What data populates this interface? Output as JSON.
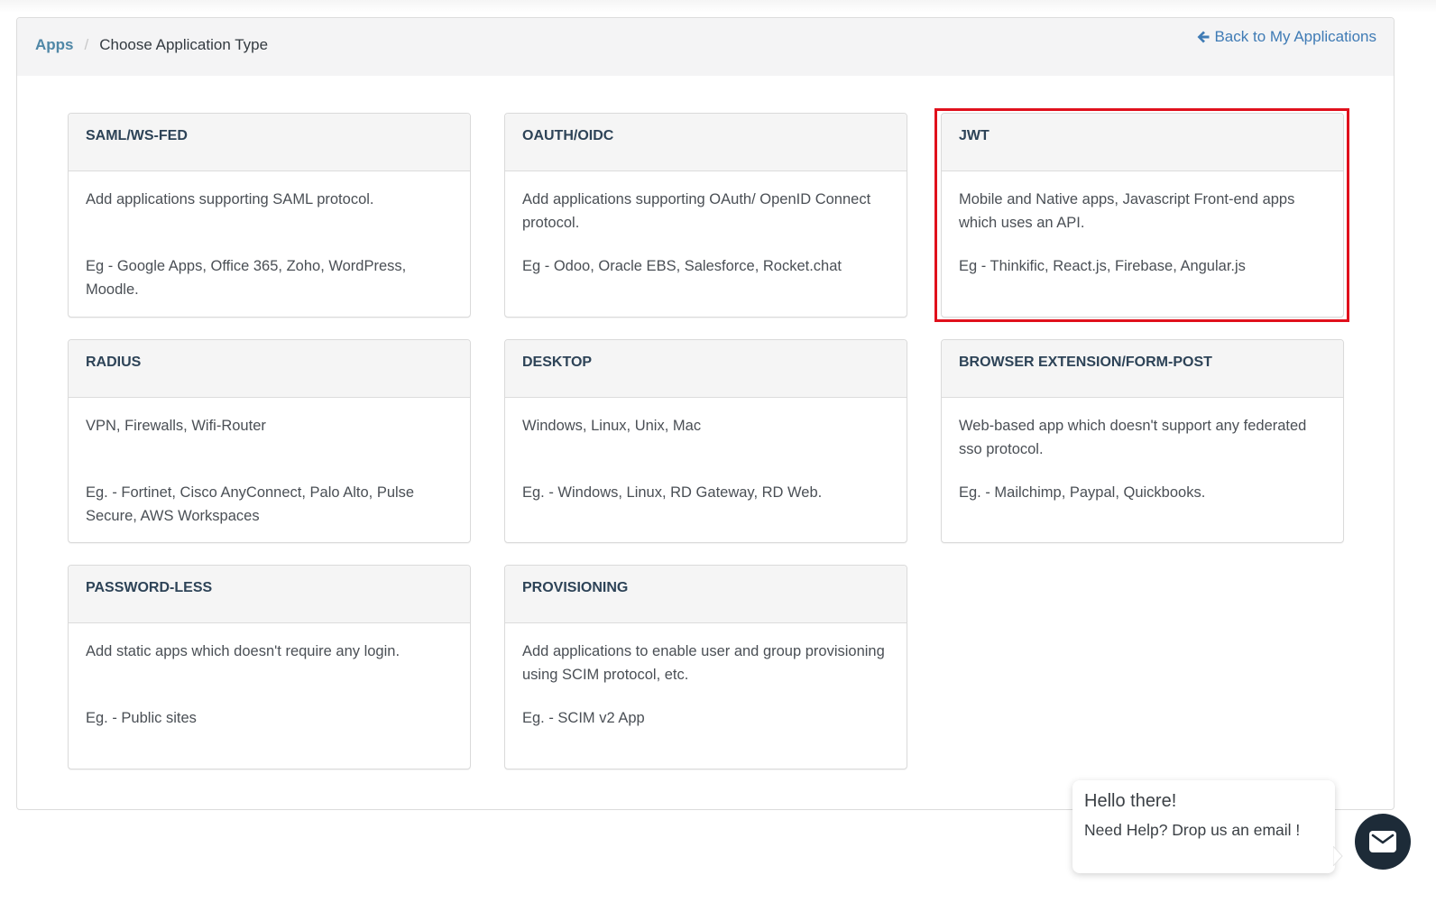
{
  "breadcrumb": {
    "root": "Apps",
    "separator": "/",
    "current": "Choose Application Type"
  },
  "header": {
    "back_link": "Back to My Applications",
    "back_icon": "arrow-left-icon"
  },
  "cards": [
    {
      "title": "SAML/WS-FED",
      "description": "Add applications supporting SAML protocol.",
      "examples": "Eg - Google Apps, Office 365, Zoho, WordPress, Moodle."
    },
    {
      "title": "OAUTH/OIDC",
      "description": "Add applications supporting OAuth/ OpenID Connect protocol.",
      "examples": "Eg - Odoo, Oracle EBS, Salesforce, Rocket.chat"
    },
    {
      "title": "JWT",
      "description": "Mobile and Native apps, Javascript Front-end apps which uses an API.",
      "examples": "Eg - Thinkific, React.js, Firebase, Angular.js",
      "highlighted": true
    },
    {
      "title": "RADIUS",
      "description": "VPN, Firewalls, Wifi-Router",
      "examples": "Eg. - Fortinet, Cisco AnyConnect, Palo Alto, Pulse Secure, AWS Workspaces"
    },
    {
      "title": "DESKTOP",
      "description": "Windows, Linux, Unix, Mac",
      "examples": "Eg. - Windows, Linux, RD Gateway, RD Web."
    },
    {
      "title": "BROWSER EXTENSION/FORM-POST",
      "description": "Web-based app which doesn't support any federated sso protocol.",
      "examples": "Eg. - Mailchimp, Paypal, Quickbooks."
    },
    {
      "title": "PASSWORD-LESS",
      "description": "Add static apps which doesn't require any login.",
      "examples": "Eg. - Public sites"
    },
    {
      "title": "PROVISIONING",
      "description": "Add applications to enable user and group provisioning using SCIM protocol, etc.",
      "examples": "Eg. - SCIM v2 App"
    }
  ],
  "chat": {
    "title": "Hello there!",
    "text": "Need Help? Drop us an email !",
    "icon": "envelope-icon"
  },
  "colors": {
    "link": "#4f87a6",
    "back_link": "#3f7bb5",
    "card_title": "#2d4357",
    "highlight": "#e0101c",
    "chat_button": "#1d2b38"
  }
}
